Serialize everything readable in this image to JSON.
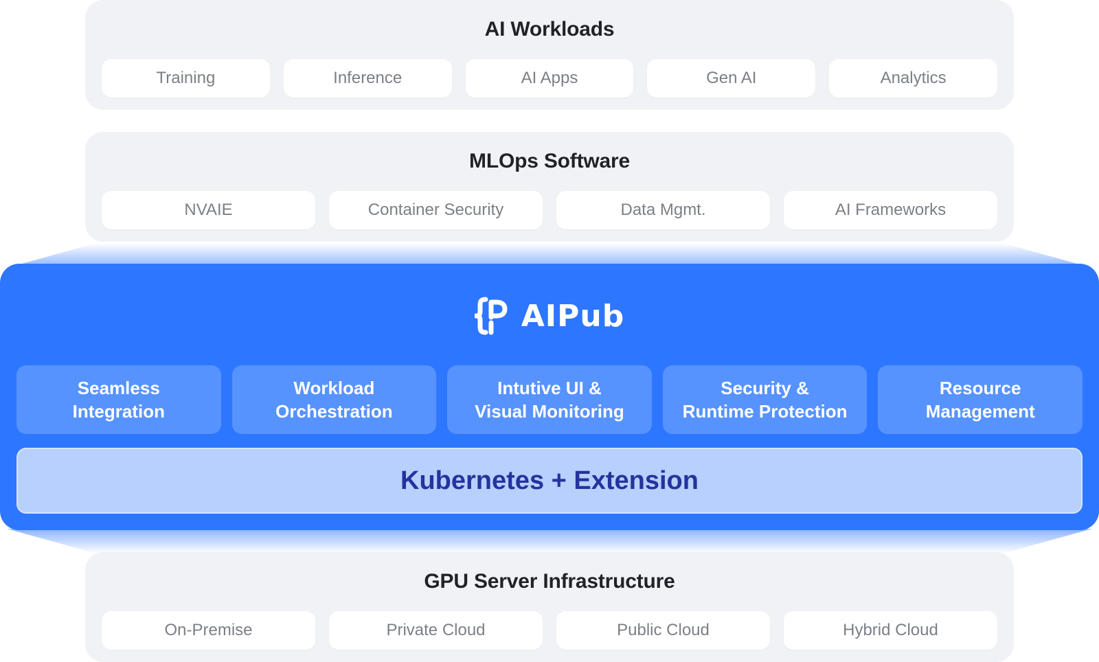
{
  "colors": {
    "layer_background": "#f1f2f5",
    "pill_background": "#ffffff",
    "pill_text": "#7b7f86",
    "title_text": "#1f2329",
    "aipub_blue": "#2d76ff",
    "feature_box": "#5693ff",
    "kubernetes_bar": "#b7d0fd",
    "kubernetes_text": "#24339e"
  },
  "ai_workloads": {
    "title": "AI Workloads",
    "items": [
      "Training",
      "Inference",
      "AI Apps",
      "Gen AI",
      "Analytics"
    ]
  },
  "mlops_software": {
    "title": "MLOps Software",
    "items": [
      "NVAIE",
      "Container Security",
      "Data Mgmt.",
      "AI Frameworks"
    ]
  },
  "aipub": {
    "logo_icon": "aipub-logo-icon",
    "brand_name": "AIPub",
    "features": [
      "Seamless\nIntegration",
      "Workload\nOrchestration",
      "Intutive UI &\nVisual Monitoring",
      "Security &\nRuntime Protection",
      "Resource\nManagement"
    ],
    "kubernetes_label": "Kubernetes + Extension"
  },
  "gpu_infrastructure": {
    "title": "GPU Server Infrastructure",
    "items": [
      "On-Premise",
      "Private Cloud",
      "Public Cloud",
      "Hybrid Cloud"
    ]
  }
}
